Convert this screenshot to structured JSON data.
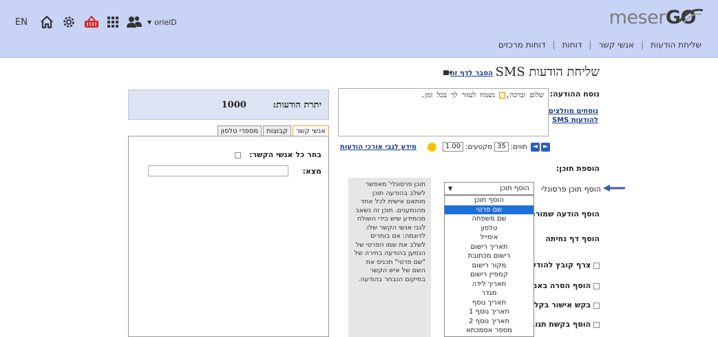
{
  "header": {
    "logo_part1": "meser",
    "logo_part2": "GO",
    "lang": "EN",
    "username": "orielD",
    "nav": [
      "שליחת הודעות",
      "אנשי קשר",
      "דוחות",
      "דוחות מרכזים"
    ]
  },
  "page": {
    "title": "שליחת הודעות SMS",
    "help_link": "הסבר לדף זה"
  },
  "message": {
    "label": "נוסח ההודעה:",
    "text_before": "שלום וברכה,",
    "text_after": "נשמח לעזור לך בכל זמן.",
    "templates_link": "נוסחים מוזלצים להודעות SMS",
    "chars_label": "תווים:",
    "chars_value": "35",
    "segments_label": "מקטעים:",
    "segments_value": "1.00",
    "long_msg_link": "מידע לגבי אורכי הודעות"
  },
  "add_content": {
    "section_label": "הוספת תוכן:",
    "personal_label": "הוסף תוכן פרסונלי",
    "saved_label": "הוסף הודעה שמורה",
    "landing_label": "הוסף דף נחיתה",
    "checkbox_1": "צרף קובץ להודעה",
    "checkbox_2": "הוסף הסרה באמצעות",
    "checkbox_3": "בקש אישור בקליק",
    "checkbox_4": "הוסף בקשת תגובה",
    "select_value": "הוסף תוכן",
    "options": [
      "הוסף תוכן",
      "שם פרטי",
      "שם משפחה",
      "טלפון",
      "אימייל",
      "תאריך רישום",
      "רישום מכתובת",
      "מקור רישום",
      "קמפיין רישום",
      "תאריך לידה",
      "מגדר",
      "תאריך נוסף",
      "תאריך נוסף 1",
      "תאריך נוסף 2",
      "מספר אסמכתא",
      "מזהה אישית"
    ],
    "selected_option": "שם פרטי",
    "hint": "תוכן פרסונלי' מאפשר לשלב בהודעה תוכן מותאם אישית לכל אחד מהנמענים. תוכן זה נשאב מהמידע שיש בידי השולח לגבי אנשי הקשר שלו. לדוגמה: אם בוחרים לשלב את שמו הפרטי של הנמען בהודעה בחירה של \"שם פרטי\" תכניס את השם של איש הקשר במיקום הנבחר בהודעה."
  },
  "recipients": {
    "credits_label": "יתרת הודעות:",
    "credits_value": "1000",
    "tabs": [
      "אנשי קשר",
      "קבוצות",
      "מספרי טלפון"
    ],
    "select_all": "בחר כל אנשי הקשר:",
    "search_label": "מצא:",
    "search_value": ""
  },
  "colors": {
    "header_bg": "#c8d3f6",
    "link": "#1a3a8c",
    "selected_option": "#1e6fd9",
    "basket_red": "#d62020"
  }
}
